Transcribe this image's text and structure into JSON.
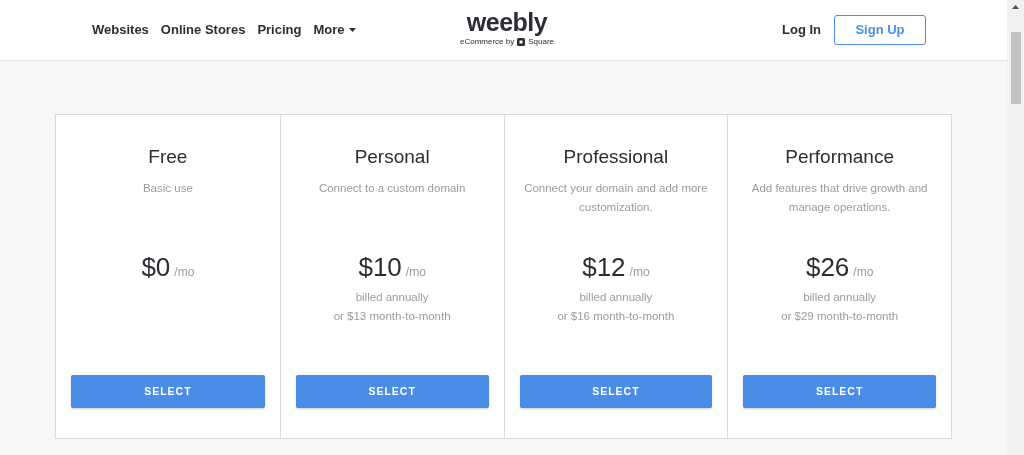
{
  "nav": {
    "links": [
      "Websites",
      "Online Stores",
      "Pricing"
    ],
    "more": "More",
    "logo": "weebly",
    "tagline_prefix": "eCommerce by",
    "tagline_brand": "Square",
    "login": "Log In",
    "signup": "Sign Up"
  },
  "plans": [
    {
      "name": "Free",
      "description": "Basic use",
      "price": "$0",
      "period": "/mo",
      "button": "SELECT"
    },
    {
      "name": "Personal",
      "description": "Connect to a custom domain",
      "price": "$10",
      "period": "/mo",
      "billing": [
        "billed annually",
        "or $13 month-to-month"
      ],
      "button": "SELECT"
    },
    {
      "name": "Professional",
      "description": "Connect your domain and add more customization.",
      "price": "$12",
      "period": "/mo",
      "billing": [
        "billed annually",
        "or $16 month-to-month"
      ],
      "button": "SELECT"
    },
    {
      "name": "Performance",
      "description": "Add features that drive growth and manage operations.",
      "price": "$26",
      "period": "/mo",
      "billing": [
        "billed annually",
        "or $29 month-to-month"
      ],
      "button": "SELECT"
    }
  ]
}
